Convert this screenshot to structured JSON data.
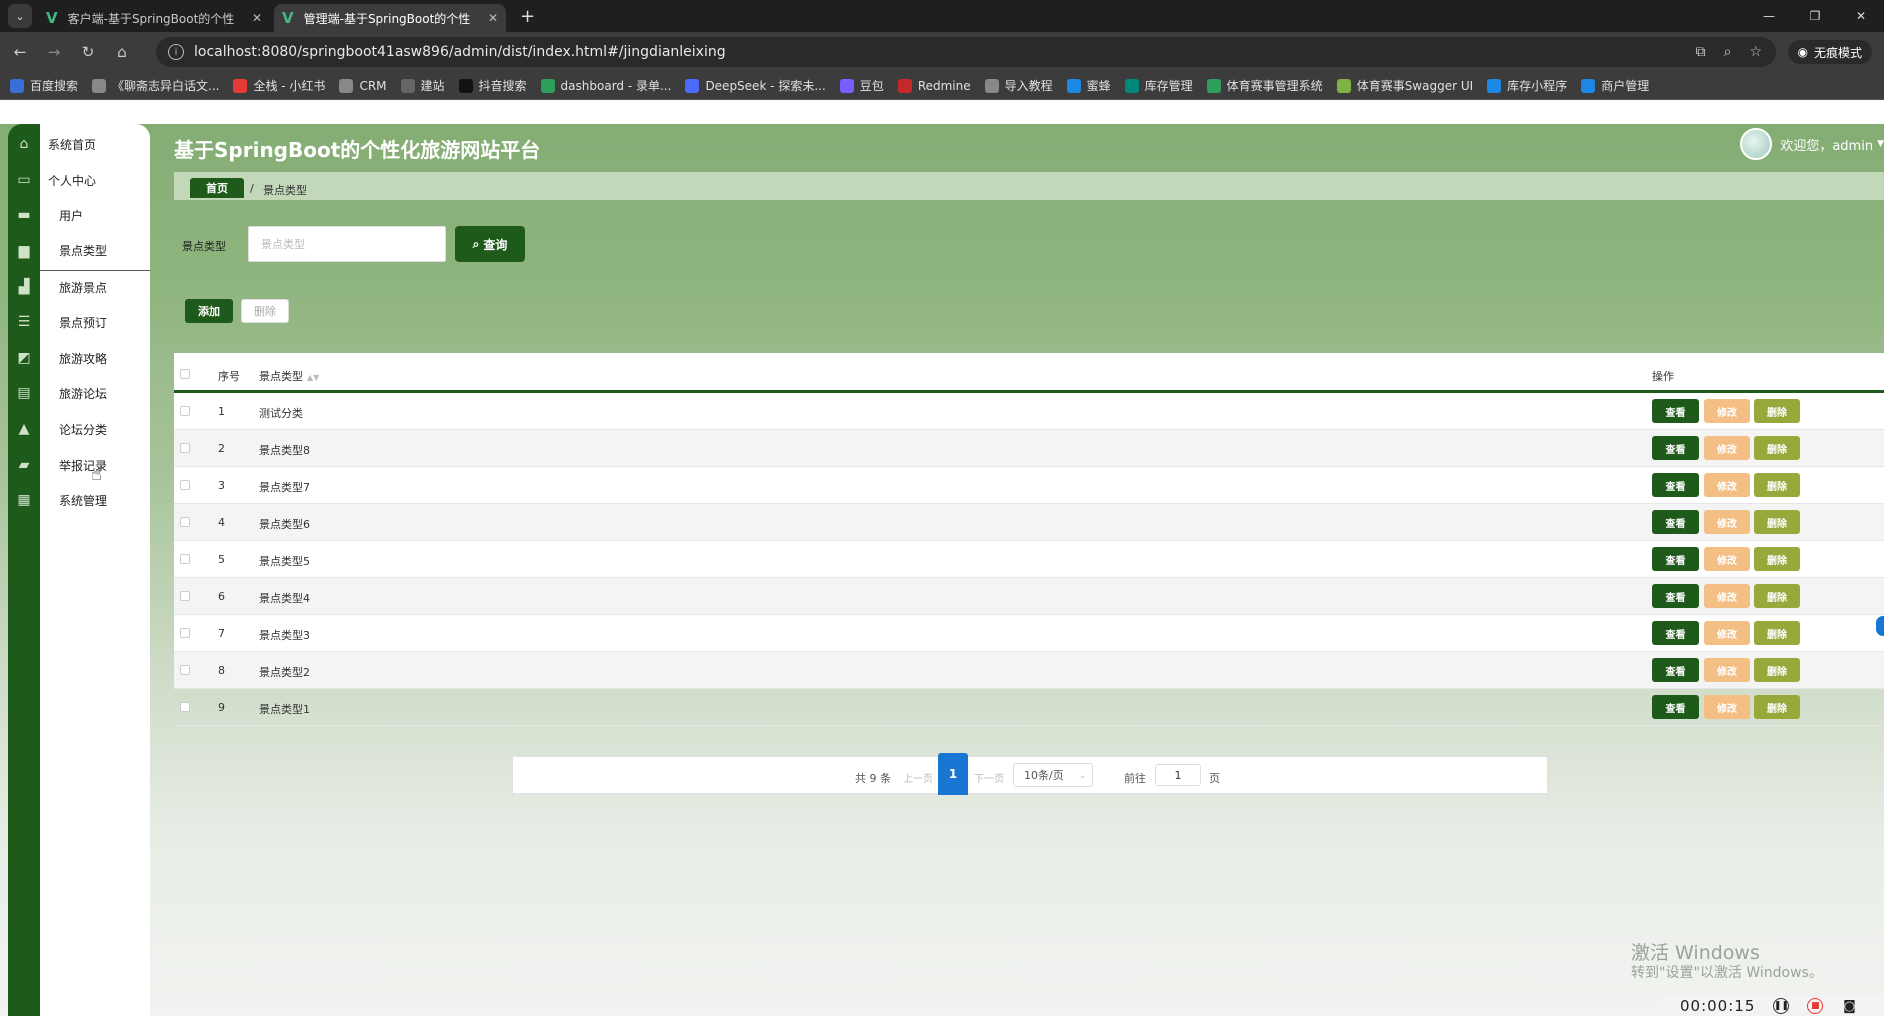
{
  "browser": {
    "tabs": [
      {
        "title": "客户端-基于SpringBoot的个性"
      },
      {
        "title": "管理端-基于SpringBoot的个性"
      }
    ],
    "url": "localhost:8080/springboot41asw896/admin/dist/index.html#/jingdianleixing",
    "incognito_label": "无痕模式",
    "bookmarks": [
      "百度搜索",
      "《聊斋志异白话文...",
      "全栈 - 小红书",
      "CRM",
      "建站",
      "抖音搜索",
      "dashboard - 录单...",
      "DeepSeek - 探索未...",
      "豆包",
      "Redmine",
      "导入教程",
      "蜜蜂",
      "库存管理",
      "体育赛事管理系统",
      "体育赛事Swagger UI",
      "库存小程序",
      "商户管理"
    ]
  },
  "sidebar": {
    "items": [
      {
        "label": "系统首页",
        "icon": "home-icon"
      },
      {
        "label": "个人中心",
        "icon": "card-icon"
      },
      {
        "label": "用户",
        "icon": "chat-icon"
      },
      {
        "label": "景点类型",
        "icon": "briefcase-icon"
      },
      {
        "label": "旅游景点",
        "icon": "thumb-icon"
      },
      {
        "label": "景点预订",
        "icon": "sliders-icon"
      },
      {
        "label": "旅游攻略",
        "icon": "chart-icon"
      },
      {
        "label": "旅游论坛",
        "icon": "clipboard-icon"
      },
      {
        "label": "论坛分类",
        "icon": "user-icon"
      },
      {
        "label": "举报记录",
        "icon": "ticket-icon"
      },
      {
        "label": "系统管理",
        "icon": "grid-icon"
      }
    ]
  },
  "header": {
    "title": "基于SpringBoot的个性化旅游网站平台",
    "welcome": "欢迎您，admin"
  },
  "breadcrumb": {
    "home": "首页",
    "separator": "/",
    "current": "景点类型"
  },
  "search": {
    "label": "景点类型",
    "placeholder": "景点类型",
    "button": "查询"
  },
  "actions": {
    "add": "添加",
    "delete": "删除"
  },
  "table": {
    "columns": {
      "index": "序号",
      "name": "景点类型",
      "ops": "操作"
    },
    "rows": [
      {
        "index": "1",
        "name": "测试分类"
      },
      {
        "index": "2",
        "name": "景点类型8"
      },
      {
        "index": "3",
        "name": "景点类型7"
      },
      {
        "index": "4",
        "name": "景点类型6"
      },
      {
        "index": "5",
        "name": "景点类型5"
      },
      {
        "index": "6",
        "name": "景点类型4"
      },
      {
        "index": "7",
        "name": "景点类型3"
      },
      {
        "index": "8",
        "name": "景点类型2"
      },
      {
        "index": "9",
        "name": "景点类型1"
      }
    ],
    "op_labels": {
      "view": "查看",
      "edit": "修改",
      "delete": "删除"
    }
  },
  "pagination": {
    "total": "共 9 条",
    "prev": "上一页",
    "current": "1",
    "next": "下一页",
    "page_size": "10条/页",
    "goto": "前往",
    "goto_value": "1",
    "page_suffix": "页"
  },
  "watermark": {
    "line1": "激活 Windows",
    "line2": "转到\"设置\"以激活 Windows。"
  },
  "recorder": {
    "time": "00:00:15"
  },
  "colors": {
    "primary": "#1e5a19",
    "edit": "#f4bf85",
    "delete": "#99a83b",
    "pager": "#1976d2"
  }
}
